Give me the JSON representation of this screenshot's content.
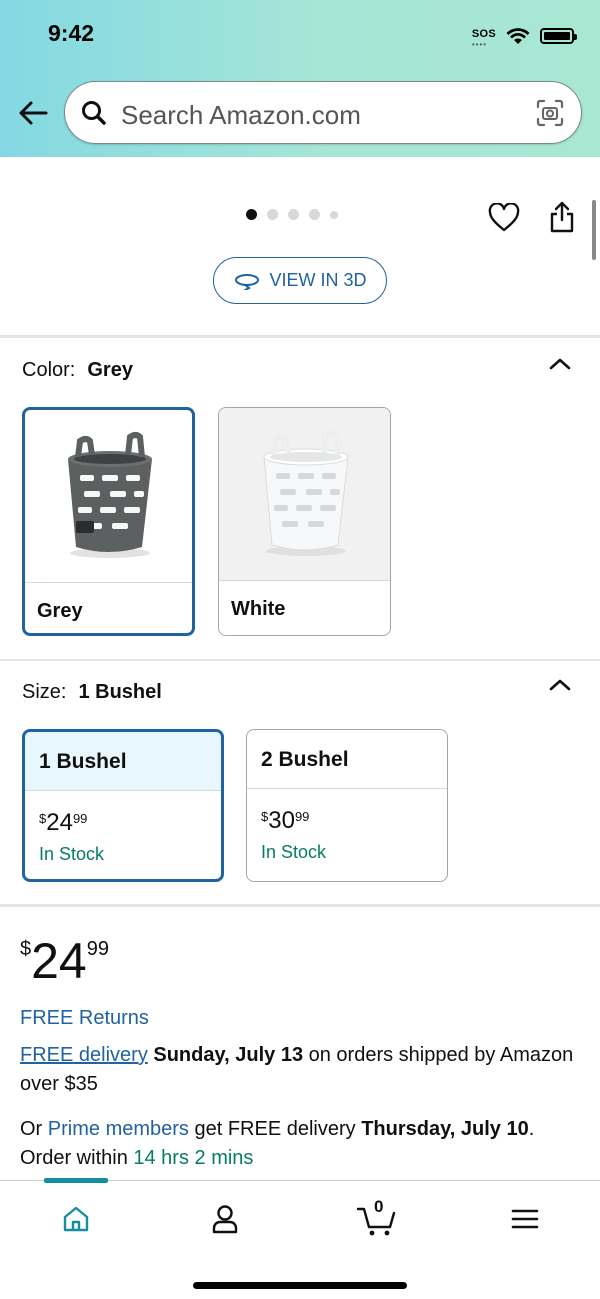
{
  "status": {
    "time": "9:42",
    "sos": "SOS"
  },
  "search": {
    "placeholder": "Search Amazon.com"
  },
  "gallery": {
    "view3d_label": "VIEW IN 3D"
  },
  "color": {
    "label": "Color:",
    "selected": "Grey",
    "options": [
      {
        "name": "Grey",
        "selected": true,
        "swatch_color": "#5d6061"
      },
      {
        "name": "White",
        "selected": false,
        "swatch_color": "#f4f5f6"
      }
    ]
  },
  "size": {
    "label": "Size:",
    "selected": "1 Bushel",
    "options": [
      {
        "name": "1 Bushel",
        "currency": "$",
        "whole": "24",
        "cents": "99",
        "stock": "In Stock",
        "selected": true
      },
      {
        "name": "2 Bushel",
        "currency": "$",
        "whole": "30",
        "cents": "99",
        "stock": "In Stock",
        "selected": false
      }
    ]
  },
  "price": {
    "currency": "$",
    "whole": "24",
    "cents": "99"
  },
  "free_returns": "FREE Returns",
  "delivery": {
    "link": "FREE delivery",
    "date": "Sunday, July 13",
    "rest": "on orders shipped by Amazon over $35",
    "prime_prefix": "Or",
    "prime_link": "Prime members",
    "prime_text": "get FREE delivery",
    "prime_date": "Thursday, July 10",
    "order_within": "Order within",
    "countdown": "14 hrs 2 mins"
  },
  "nav": {
    "cart_count": "0"
  },
  "colors": {
    "accent_blue": "#2162a1",
    "green": "#067d62",
    "teal": "#158e9f"
  }
}
